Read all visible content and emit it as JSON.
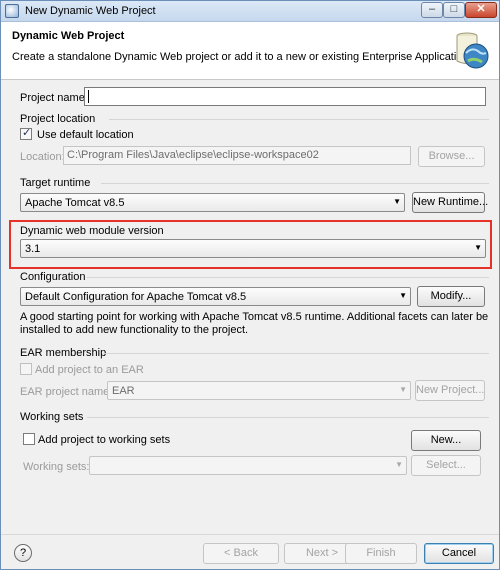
{
  "window": {
    "title": "New Dynamic Web Project",
    "minimize": "–",
    "maximize": "□",
    "close": "✕"
  },
  "banner": {
    "title": "Dynamic Web Project",
    "description": "Create a standalone Dynamic Web project or add it to a new or existing Enterprise Application.",
    "icon": "web-project-globe-icon"
  },
  "project_name": {
    "label": "Project name:",
    "value": ""
  },
  "project_location": {
    "group_label": "Project location",
    "use_default_label": "Use default location",
    "use_default_checked": true,
    "location_label": "Location:",
    "location_value": "C:\\Program Files\\Java\\eclipse\\eclipse-workspace02",
    "browse_label": "Browse..."
  },
  "target_runtime": {
    "group_label": "Target runtime",
    "selected": "Apache Tomcat v8.5",
    "new_runtime_label": "New Runtime..."
  },
  "module_version": {
    "group_label": "Dynamic web module version",
    "selected": "3.1"
  },
  "configuration": {
    "group_label": "Configuration",
    "selected": "Default Configuration for Apache Tomcat v8.5",
    "modify_label": "Modify...",
    "description_line1": "A good starting point for working with Apache Tomcat v8.5 runtime. Additional facets can later be",
    "description_line2": "installed to add new functionality to the project."
  },
  "ear": {
    "group_label": "EAR membership",
    "add_label": "Add project to an EAR",
    "add_checked": false,
    "name_label": "EAR project name:",
    "name_value": "EAR",
    "new_project_label": "New Project..."
  },
  "working_sets": {
    "group_label": "Working sets",
    "add_label": "Add project to working sets",
    "add_checked": false,
    "new_label": "New...",
    "sets_label": "Working sets:",
    "sets_value": "",
    "select_label": "Select..."
  },
  "footer": {
    "help_label": "?",
    "back_label": "< Back",
    "next_label": "Next >",
    "finish_label": "Finish",
    "cancel_label": "Cancel"
  },
  "colors": {
    "highlight_border": "#e5332a",
    "title_bar": "#c6d8ee"
  }
}
